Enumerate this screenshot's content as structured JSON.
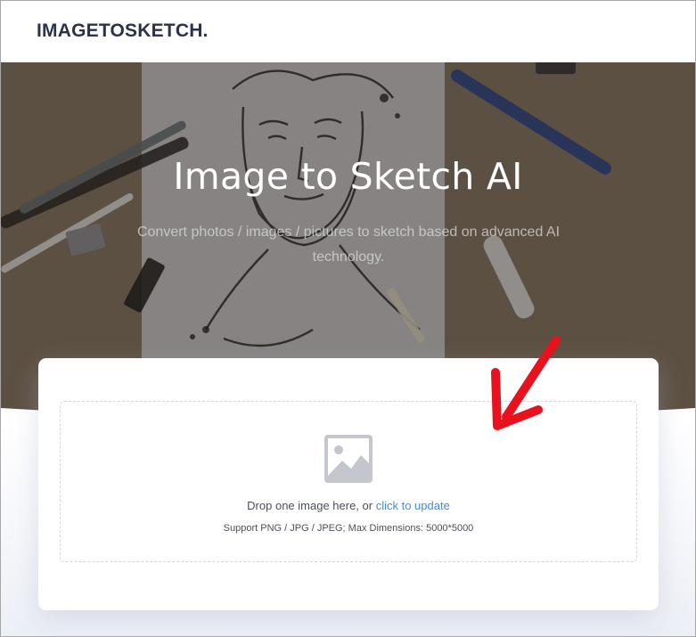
{
  "header": {
    "brand": "IMAGETOSKETCH."
  },
  "hero": {
    "title": "Image to Sketch AI",
    "subtitle": "Convert photos / images / pictures to sketch based on advanced AI technology."
  },
  "upload": {
    "prompt": "Drop one image here, or ",
    "link_label": "click to update",
    "note": "Support PNG / JPG / JPEG; Max Dimensions: 5000*5000"
  },
  "colors": {
    "brand_text": "#2b3348",
    "link": "#3d8fe0",
    "annotation_arrow": "#e8121e"
  },
  "icons": {
    "upload": "image-placeholder-icon",
    "annotation": "red-arrow-annotation"
  }
}
